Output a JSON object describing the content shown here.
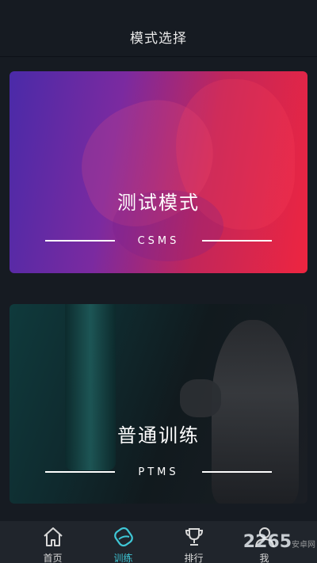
{
  "header": {
    "title": "模式选择"
  },
  "cards": [
    {
      "title": "测试模式",
      "subtitle": "CSMS"
    },
    {
      "title": "普通训练",
      "subtitle": "PTMS"
    }
  ],
  "tabbar": {
    "tabs": [
      {
        "label": "首页",
        "icon": "home-icon",
        "active": false
      },
      {
        "label": "训练",
        "icon": "training-icon",
        "active": true
      },
      {
        "label": "排行",
        "icon": "trophy-icon",
        "active": false
      },
      {
        "label": "我",
        "icon": "user-icon",
        "active": false
      }
    ],
    "active_color": "#3fc7d6"
  },
  "watermark": {
    "text": "2265",
    "small": "安卓网"
  },
  "colors": {
    "background": "#161b22",
    "tabbar": "#20252c",
    "accent": "#3fc7d6"
  }
}
